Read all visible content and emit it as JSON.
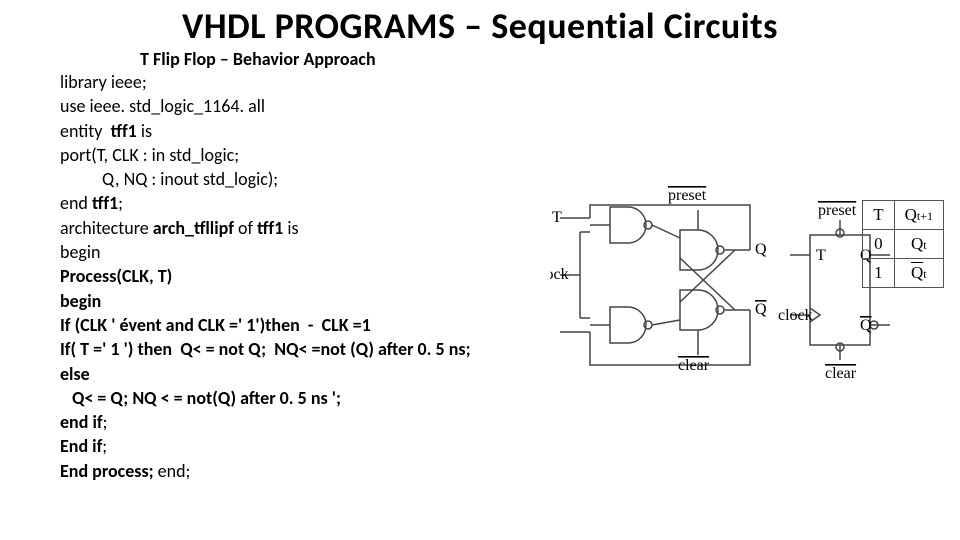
{
  "title": "VHDL PROGRAMS – Sequential  Circuits",
  "subtitle": "T Flip Flop – Behavior Approach",
  "code": {
    "l1": "library ieee;",
    "l2": "use ieee. std_logic_1164. all",
    "l3a": "entity  ",
    "l3b": "tff1",
    "l3c": " is",
    "l4": "port(T, CLK : in std_logic;",
    "l5": "Q, NQ : inout std_logic);",
    "l6a": "end ",
    "l6b": "tff1",
    "l6c": ";",
    "l7a": "architecture ",
    "l7b": "arch_tfllipf",
    "l7c": " of ",
    "l7d": "tff1",
    "l7e": " is",
    "l8": "begin",
    "l9": "Process(CLK, T)",
    "l10": "begin",
    "l11": "If (CLK ' évent and CLK =' 1')then  -  CLK =1",
    "l12": "If( T =' 1 ') then  Q< = not Q;  NQ< =not (Q) after 0. 5 ns;",
    "l13": "else",
    "l14": "Q< = Q; NQ < = not(Q) after 0. 5 ns ';",
    "l15a": "end if",
    "l15b": ";",
    "l16a": "End if",
    "l16b": ";",
    "l17a": "End process;",
    "l17b": " end;"
  },
  "diagram": {
    "left": {
      "T": "T",
      "clock": "clock",
      "preset": "preset",
      "clear": "clear",
      "Q": "Q",
      "Qbar": "Q"
    },
    "block": {
      "T": "T",
      "clock": "clock",
      "preset": "preset",
      "clear": "clear",
      "Q": "Q",
      "Qbar": "Q"
    }
  },
  "truth": {
    "h1": "T",
    "h2": "Q",
    "hsub": "t+1",
    "r1c1": "0",
    "r1c2": "Q",
    "r1sub": "t",
    "r2c1": "1",
    "r2c2": "Q",
    "r2sub": "t"
  }
}
